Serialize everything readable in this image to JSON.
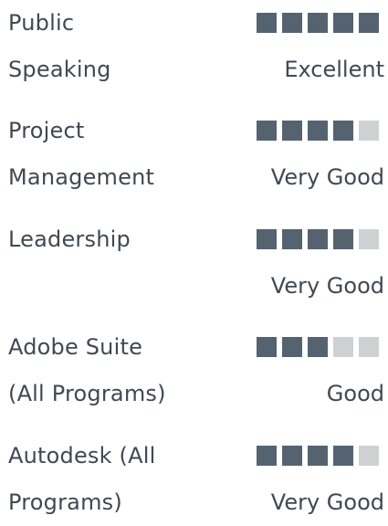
{
  "skills": [
    {
      "name_lines": [
        "Public",
        "Speaking"
      ],
      "level": "Excellent",
      "score": 5,
      "max": 5
    },
    {
      "name_lines": [
        "Project",
        "Management"
      ],
      "level": "Very Good",
      "score": 4,
      "max": 5
    },
    {
      "name_lines": [
        "Leadership",
        ""
      ],
      "level": "Very Good",
      "score": 4,
      "max": 5
    },
    {
      "name_lines": [
        "Adobe Suite",
        "(All Programs)"
      ],
      "level": "Good",
      "score": 3,
      "max": 5
    },
    {
      "name_lines": [
        "Autodesk (All",
        "Programs)"
      ],
      "level": "Very Good",
      "score": 4,
      "max": 5
    }
  ],
  "colors": {
    "text": "#3f4953",
    "filled_block": "#556371",
    "empty_block": "#cfd1d2"
  }
}
